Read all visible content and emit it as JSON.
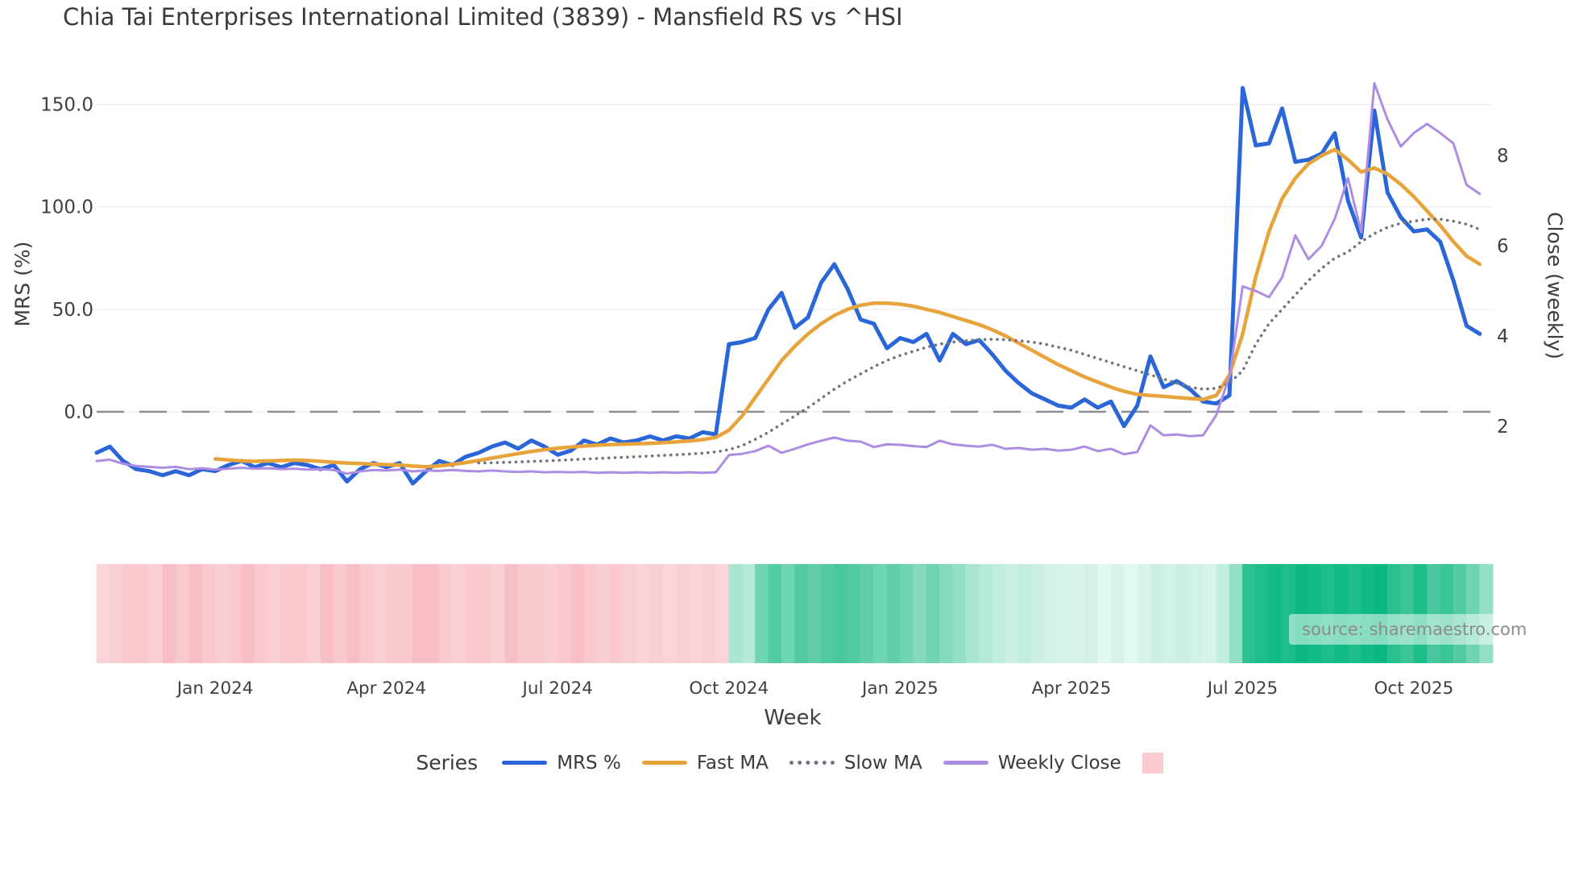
{
  "title": "Chia Tai Enterprises International Limited (3839) - Mansfield RS vs ^HSI",
  "source": "source: sharemaestro.com",
  "axes": {
    "x": {
      "label": "Week",
      "ticks": [
        {
          "week": 9,
          "label": "Jan 2024"
        },
        {
          "week": 22,
          "label": "Apr 2024"
        },
        {
          "week": 35,
          "label": "Jul 2024"
        },
        {
          "week": 48,
          "label": "Oct 2024"
        },
        {
          "week": 61,
          "label": "Jan 2025"
        },
        {
          "week": 74,
          "label": "Apr 2025"
        },
        {
          "week": 87,
          "label": "Jul 2025"
        },
        {
          "week": 100,
          "label": "Oct 2025"
        }
      ]
    },
    "left": {
      "label": "MRS (%)",
      "ticks": [
        {
          "value": 0,
          "label": "0.0"
        },
        {
          "value": 50,
          "label": "50.0"
        },
        {
          "value": 100,
          "label": "100.0"
        },
        {
          "value": 150,
          "label": "150.0"
        }
      ]
    },
    "right": {
      "label": "Close (weekly)",
      "ticks": [
        {
          "value": 2,
          "label": "2"
        },
        {
          "value": 4,
          "label": "4"
        },
        {
          "value": 6,
          "label": "6"
        },
        {
          "value": 8,
          "label": "8"
        }
      ]
    }
  },
  "legend": {
    "title": "Series",
    "items": [
      {
        "label": "MRS %",
        "style": "line",
        "color": "#2b66d9"
      },
      {
        "label": "Fast MA",
        "style": "line",
        "color": "#e8a33b"
      },
      {
        "label": "Slow MA",
        "style": "dotted",
        "color": "#6f7680"
      },
      {
        "label": "Weekly Close",
        "style": "line",
        "color": "#ad8ce4"
      },
      {
        "label": "",
        "style": "square",
        "color": "#f9cbd0"
      }
    ]
  },
  "colors": {
    "grid": "#edeef3",
    "zero_line": "#8a8f96",
    "tick_text": "#3f3f3f"
  },
  "chart_data": {
    "type": "line",
    "x_label": "Week",
    "n_points": 106,
    "left_axis_range": [
      -40,
      165
    ],
    "right_axis_range": [
      0.6,
      10.2
    ],
    "grid": "horizontal",
    "legend_position": "bottom",
    "series": [
      {
        "name": "MRS %",
        "axis": "left",
        "style": "solid",
        "color": "#2b66d9",
        "width": 5,
        "values": [
          -20,
          -17,
          -24,
          -28,
          -29,
          -31,
          -29,
          -31,
          -28,
          -29,
          -26,
          -24,
          -27,
          -25,
          -27,
          -25,
          -26,
          -28,
          -26,
          -34,
          -28,
          -25,
          -27,
          -25,
          -35,
          -29,
          -24,
          -26,
          -22,
          -20,
          -17,
          -15,
          -18,
          -14,
          -17,
          -21,
          -19,
          -14,
          -16,
          -13,
          -15,
          -14,
          -12,
          -14,
          -12,
          -13,
          -10,
          -11,
          33,
          34,
          36,
          50,
          58,
          41,
          46,
          63,
          72,
          60,
          45,
          43,
          31,
          36,
          34,
          38,
          25,
          38,
          33,
          35,
          28,
          20,
          14,
          9,
          6,
          3,
          2,
          6,
          2,
          5,
          -7,
          3,
          27,
          12,
          15,
          11,
          5,
          4,
          8,
          158,
          130,
          131,
          148,
          122,
          123,
          126,
          136,
          103,
          85,
          147,
          107,
          95,
          88,
          89,
          83,
          64,
          42,
          38
        ]
      },
      {
        "name": "Fast MA",
        "axis": "left",
        "style": "solid",
        "color": "#e8a33b",
        "width": 4.5,
        "values": [
          null,
          null,
          null,
          null,
          null,
          null,
          null,
          null,
          null,
          -23,
          -23.5,
          -24,
          -24.2,
          -24,
          -23.8,
          -23.6,
          -23.8,
          -24.2,
          -24.6,
          -25,
          -25.3,
          -25.6,
          -25.8,
          -26,
          -26.5,
          -26.8,
          -26.4,
          -25.7,
          -24.8,
          -23.8,
          -22.6,
          -21.5,
          -20.4,
          -19.4,
          -18.5,
          -17.8,
          -17.2,
          -16.7,
          -16.3,
          -16,
          -15.8,
          -15.6,
          -15.4,
          -15.1,
          -14.7,
          -14.2,
          -13.6,
          -12.5,
          -9,
          -2,
          7,
          16,
          25,
          32,
          38,
          43,
          47,
          50,
          52,
          53,
          53,
          52.5,
          51.5,
          50,
          48.5,
          46.5,
          44.5,
          42.5,
          40,
          37,
          33.5,
          30,
          26.5,
          23,
          20,
          17,
          14.5,
          12,
          10,
          8.5,
          8,
          7.5,
          7,
          6.5,
          6,
          8,
          18,
          38,
          66,
          88,
          104,
          114,
          121,
          125,
          128,
          123,
          117,
          119,
          116,
          111,
          105,
          98,
          91,
          83,
          76,
          72
        ]
      },
      {
        "name": "Slow MA",
        "axis": "left",
        "style": "dotted",
        "color": "#6f7680",
        "width": 3.6,
        "values": [
          null,
          null,
          null,
          null,
          null,
          null,
          null,
          null,
          null,
          null,
          null,
          null,
          null,
          null,
          null,
          null,
          null,
          null,
          null,
          null,
          null,
          null,
          null,
          null,
          null,
          null,
          null,
          null,
          null,
          -25,
          -24.9,
          -24.7,
          -24.5,
          -24.2,
          -24,
          -23.7,
          -23.4,
          -23.1,
          -22.8,
          -22.5,
          -22.2,
          -21.9,
          -21.6,
          -21.3,
          -21,
          -20.6,
          -20.2,
          -19.6,
          -18.5,
          -16.5,
          -13.5,
          -10,
          -6,
          -2,
          2,
          6.5,
          11,
          15,
          18.5,
          22,
          25,
          27.5,
          29.5,
          31.5,
          33,
          34,
          34.7,
          35.2,
          35.4,
          35.2,
          34.7,
          34,
          33,
          31.5,
          30,
          28,
          26,
          24,
          22,
          20,
          18,
          16,
          14,
          12,
          11,
          11.5,
          14,
          20,
          33,
          43,
          50,
          57,
          64,
          70,
          75,
          78,
          83,
          87,
          90,
          92,
          93,
          94,
          94,
          93,
          91.5,
          89
        ]
      },
      {
        "name": "Weekly Close",
        "axis": "right",
        "style": "solid",
        "color": "#ad8ce4",
        "width": 3,
        "values": [
          1.23,
          1.26,
          1.17,
          1.12,
          1.1,
          1.08,
          1.1,
          1.05,
          1.07,
          1.04,
          1.06,
          1.08,
          1.06,
          1.07,
          1.05,
          1.06,
          1.04,
          1.05,
          1.03,
          0.95,
          1.0,
          1.03,
          1.02,
          1.04,
          1.0,
          1.02,
          1.01,
          1.03,
          1.01,
          1.0,
          1.02,
          1.0,
          0.99,
          1.0,
          0.98,
          0.99,
          0.98,
          0.99,
          0.97,
          0.98,
          0.97,
          0.98,
          0.97,
          0.98,
          0.97,
          0.98,
          0.97,
          0.98,
          1.36,
          1.39,
          1.45,
          1.57,
          1.41,
          1.5,
          1.6,
          1.68,
          1.75,
          1.68,
          1.66,
          1.54,
          1.6,
          1.59,
          1.56,
          1.54,
          1.68,
          1.6,
          1.57,
          1.55,
          1.59,
          1.5,
          1.52,
          1.48,
          1.5,
          1.46,
          1.48,
          1.55,
          1.45,
          1.5,
          1.38,
          1.43,
          2.02,
          1.8,
          1.82,
          1.78,
          1.8,
          2.25,
          3.1,
          5.1,
          5.0,
          4.86,
          5.3,
          6.23,
          5.7,
          6.0,
          6.6,
          7.5,
          6.3,
          9.6,
          8.8,
          8.2,
          8.5,
          8.7,
          8.5,
          8.27,
          7.35,
          7.15
        ]
      }
    ],
    "band": {
      "description": "weekly relative-strength heat band below plot",
      "colors": [
        "#fbd4d8",
        "#facfd3",
        "#f9c9ce",
        "#f9c9ce",
        "#facfd3",
        "#f7bfc5",
        "#f9c9ce",
        "#f7bfc5",
        "#f9c9ce",
        "#facfd3",
        "#f9c9ce",
        "#f7bfc5",
        "#f9c9ce",
        "#facfd3",
        "#f9c9ce",
        "#f9c9ce",
        "#facfd3",
        "#f7bfc5",
        "#f9c9ce",
        "#f7bfc5",
        "#f9c9ce",
        "#facfd3",
        "#f9c9ce",
        "#f9c9ce",
        "#f7bfc5",
        "#f7bfc5",
        "#f9c9ce",
        "#facfd3",
        "#f9c9ce",
        "#f9c9ce",
        "#facfd3",
        "#f7bfc5",
        "#f9c9ce",
        "#f9c9ce",
        "#facfd3",
        "#f9c9ce",
        "#f7bfc5",
        "#f9c9ce",
        "#facfd3",
        "#f9c9ce",
        "#facfd3",
        "#fbd4d8",
        "#facfd3",
        "#fbd4d8",
        "#facfd3",
        "#fbd4d8",
        "#facfd3",
        "#fbd4d8",
        "#a9e6d1",
        "#b4e9d7",
        "#6fd4b1",
        "#52cba3",
        "#6fd4b1",
        "#52cba3",
        "#60cfa9",
        "#52cba3",
        "#47c89d",
        "#52cba3",
        "#60cfa9",
        "#6fd4b1",
        "#60cfa9",
        "#6fd4b1",
        "#85dabb",
        "#6fd4b1",
        "#85dabb",
        "#93dfc5",
        "#a9e6d1",
        "#b4e9d7",
        "#c2eede",
        "#cbf0e3",
        "#c2eede",
        "#cbf0e3",
        "#d2f2e7",
        "#d8f4ea",
        "#d8f4ea",
        "#d2f2e7",
        "#e3f8f0",
        "#d8f4ea",
        "#e3f8f0",
        "#d8f4ea",
        "#cbf0e3",
        "#d2f2e7",
        "#cbf0e3",
        "#d2f2e7",
        "#d8f4ea",
        "#c2eede",
        "#93dfc5",
        "#2dc192",
        "#1dbe8c",
        "#12ba85",
        "#1dbe8c",
        "#0cb881",
        "#12ba85",
        "#1dbe8c",
        "#12ba85",
        "#1dbe8c",
        "#12ba85",
        "#0cb881",
        "#29c090",
        "#3bc597",
        "#1dbe8c",
        "#47c89d",
        "#3bc597",
        "#52cba3",
        "#6fd4b1",
        "#93dfc5"
      ]
    }
  }
}
